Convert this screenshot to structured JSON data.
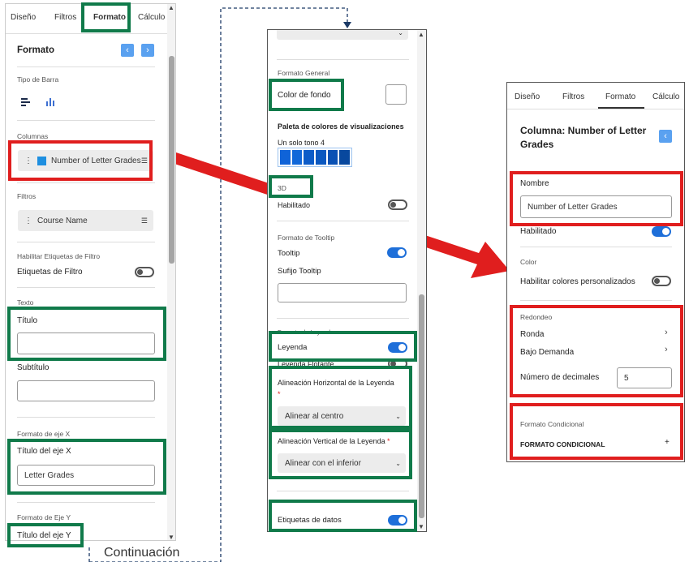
{
  "colors": {
    "green": "#107a4a",
    "red": "#e01e1e",
    "accent": "#1e6fd9",
    "swatch_dark": "#0a4fb0"
  },
  "left": {
    "tabs": [
      "Diseño",
      "Filtros",
      "Formato",
      "Cálculo"
    ],
    "title": "Formato",
    "tipo_barra": "Tipo de Barra",
    "columnas": "Columnas",
    "column_item": "Number of Letter Grades",
    "filtros": "Filtros",
    "filter_item": "Course Name",
    "habilitar_etiquetas": "Habilitar Etiquetas de Filtro",
    "etiquetas_filtro": "Etiquetas de Filtro",
    "texto": "Texto",
    "titulo": "Título",
    "subtitulo": "Subtítulo",
    "formato_eje_x": "Formato de eje X",
    "titulo_eje_x": "Título del eje X",
    "eje_x_value": "Letter Grades",
    "formato_eje_y": "Formato de Eje Y",
    "titulo_eje_y": "Título del eje Y"
  },
  "continuation": "Continuación",
  "middle": {
    "formato_general": "Formato General",
    "color_fondo": "Color de fondo",
    "paleta": "Paleta de colores de visualizaciones",
    "un_solo_tono": "Un solo tono 4",
    "swatches": [
      "#0f63d8",
      "#1168d9",
      "#0c5cc8",
      "#0b58c0",
      "#0a51b4",
      "#08489e"
    ],
    "d3": "3D",
    "habilitado": "Habilitado",
    "formato_tooltip": "Formato de Tooltip",
    "tooltip": "Tooltip",
    "sufijo": "Sufijo Tooltip",
    "formato_leyenda": "Formato de Leyenda",
    "leyenda": "Leyenda",
    "leyenda_flotante": "Leyenda Flotante",
    "alin_h": "Alineación Horizontal de la Leyenda",
    "alin_h_value": "Alinear al centro",
    "alin_v": "Alineación Vertical de la Leyenda",
    "alin_v_value": "Alinear con el inferior",
    "etiquetas_datos": "Etiquetas de datos",
    "required": "*"
  },
  "right": {
    "tabs": [
      "Diseño",
      "Filtros",
      "Formato",
      "Cálculo"
    ],
    "title": "Columna: Number of Letter Grades",
    "nombre": "Nombre",
    "nombre_value": "Number of Letter Grades",
    "habilitado": "Habilitado",
    "color": "Color",
    "habilitar_colores": "Habilitar colores personalizados",
    "redondeo": "Redondeo",
    "ronda": "Ronda",
    "bajo_demanda": "Bajo Demanda",
    "num_decimales": "Número de decimales",
    "decimales_value": "5",
    "formato_condicional": "Formato Condicional",
    "formato_condicional_caps": "FORMATO CONDICIONAL",
    "plus": "+"
  }
}
